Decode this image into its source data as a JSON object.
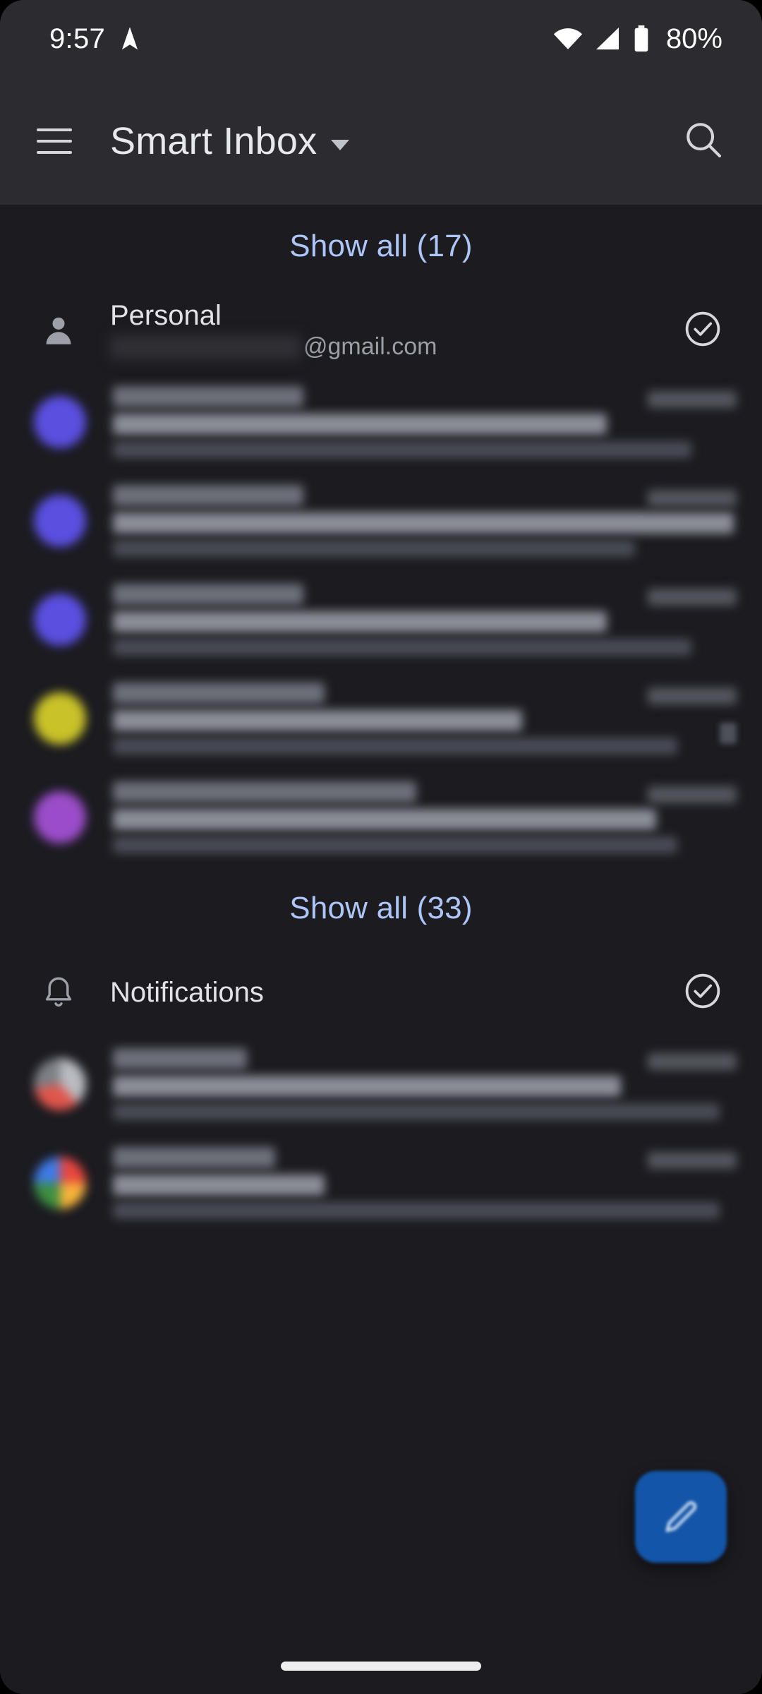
{
  "status_bar": {
    "time": "9:57",
    "battery_percent": "80%",
    "icons": [
      "location-arrow-icon",
      "wifi-icon",
      "cellular-signal-icon",
      "battery-icon"
    ]
  },
  "app_bar": {
    "menu_icon": "hamburger-menu-icon",
    "title": "Smart Inbox",
    "dropdown_icon": "chevron-down-icon",
    "search_icon": "search-icon"
  },
  "colors": {
    "accent_link": "#AEC6F7",
    "app_bar_bg": "#2B2B30",
    "list_bg": "#1B1B20",
    "fab_bg": "#1355A8"
  },
  "top_show_all": {
    "label": "Show all (17)",
    "count": 17
  },
  "sections": [
    {
      "id": "personal",
      "icon": "person-icon",
      "title": "Personal",
      "subtitle_suffix": "@gmail.com",
      "subtitle_redacted": true,
      "action_icon": "check-circle-icon",
      "rows": [
        {
          "avatar_color": "#5B4FE0",
          "redacted": true,
          "has_attachment": false,
          "sender_w": 270,
          "subject_w": 700,
          "preview_w": 820,
          "time_w": 126
        },
        {
          "avatar_color": "#5B4FE0",
          "redacted": true,
          "has_attachment": false,
          "sender_w": 270,
          "subject_w": 880,
          "preview_w": 740,
          "time_w": 126
        },
        {
          "avatar_color": "#5B4FE0",
          "redacted": true,
          "has_attachment": false,
          "sender_w": 270,
          "subject_w": 700,
          "preview_w": 820,
          "time_w": 126
        },
        {
          "avatar_color": "#C9C229",
          "redacted": true,
          "has_attachment": true,
          "sender_w": 300,
          "subject_w": 580,
          "preview_w": 800,
          "time_w": 126
        },
        {
          "avatar_color": "#9B4DC9",
          "redacted": true,
          "has_attachment": false,
          "sender_w": 430,
          "subject_w": 770,
          "preview_w": 800,
          "time_w": 126
        }
      ],
      "show_all": {
        "label": "Show all (33)",
        "count": 33
      }
    },
    {
      "id": "notifications",
      "icon": "bell-icon",
      "title": "Notifications",
      "subtitle_suffix": "",
      "subtitle_redacted": false,
      "action_icon": "check-circle-icon",
      "rows": [
        {
          "avatar_color": "multicolor-red-white",
          "redacted": true,
          "has_attachment": false,
          "sender_w": 190,
          "subject_w": 720,
          "preview_w": 860,
          "time_w": 126
        },
        {
          "avatar_color": "multicolor-google",
          "redacted": true,
          "has_attachment": false,
          "sender_w": 230,
          "subject_w": 300,
          "preview_w": 860,
          "time_w": 126
        }
      ],
      "show_all": null
    }
  ],
  "fab": {
    "icon": "compose-pencil-icon",
    "label": "Compose"
  },
  "nav_bar": {
    "gesture_pill": "home-indicator"
  }
}
